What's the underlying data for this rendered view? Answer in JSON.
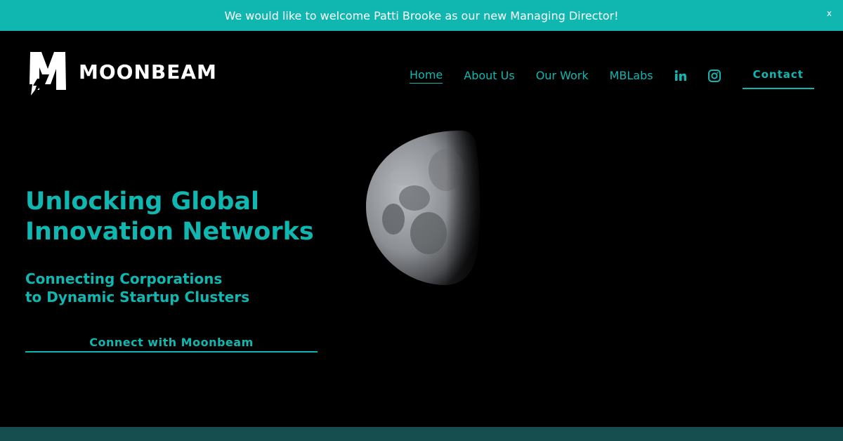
{
  "announcement": {
    "text": "We would like to welcome Patti Brooke as our new Managing Director!",
    "close_label": "x"
  },
  "brand": {
    "name": "MOONBEAM",
    "logo_icon": "moonbeam-m-bolt-logo"
  },
  "nav": {
    "items": [
      {
        "label": "Home",
        "active": true
      },
      {
        "label": "About Us",
        "active": false
      },
      {
        "label": "Our Work",
        "active": false
      },
      {
        "label": "MBLabs",
        "active": false
      }
    ],
    "social": [
      {
        "name": "linkedin-icon",
        "glyph": "in"
      },
      {
        "name": "instagram-icon"
      }
    ],
    "contact_label": "Contact"
  },
  "hero": {
    "title_line1": "Unlocking Global",
    "title_line2": "Innovation Networks",
    "subtitle_line1": "Connecting Corporations",
    "subtitle_line2": "to Dynamic Startup Clusters",
    "cta_label": "Connect with Moonbeam",
    "image": "half-moon-photo"
  },
  "colors": {
    "accent": "#10b7b1",
    "background": "#000000",
    "footer_band": "#164e50",
    "text_on_accent": "#ffffff"
  }
}
